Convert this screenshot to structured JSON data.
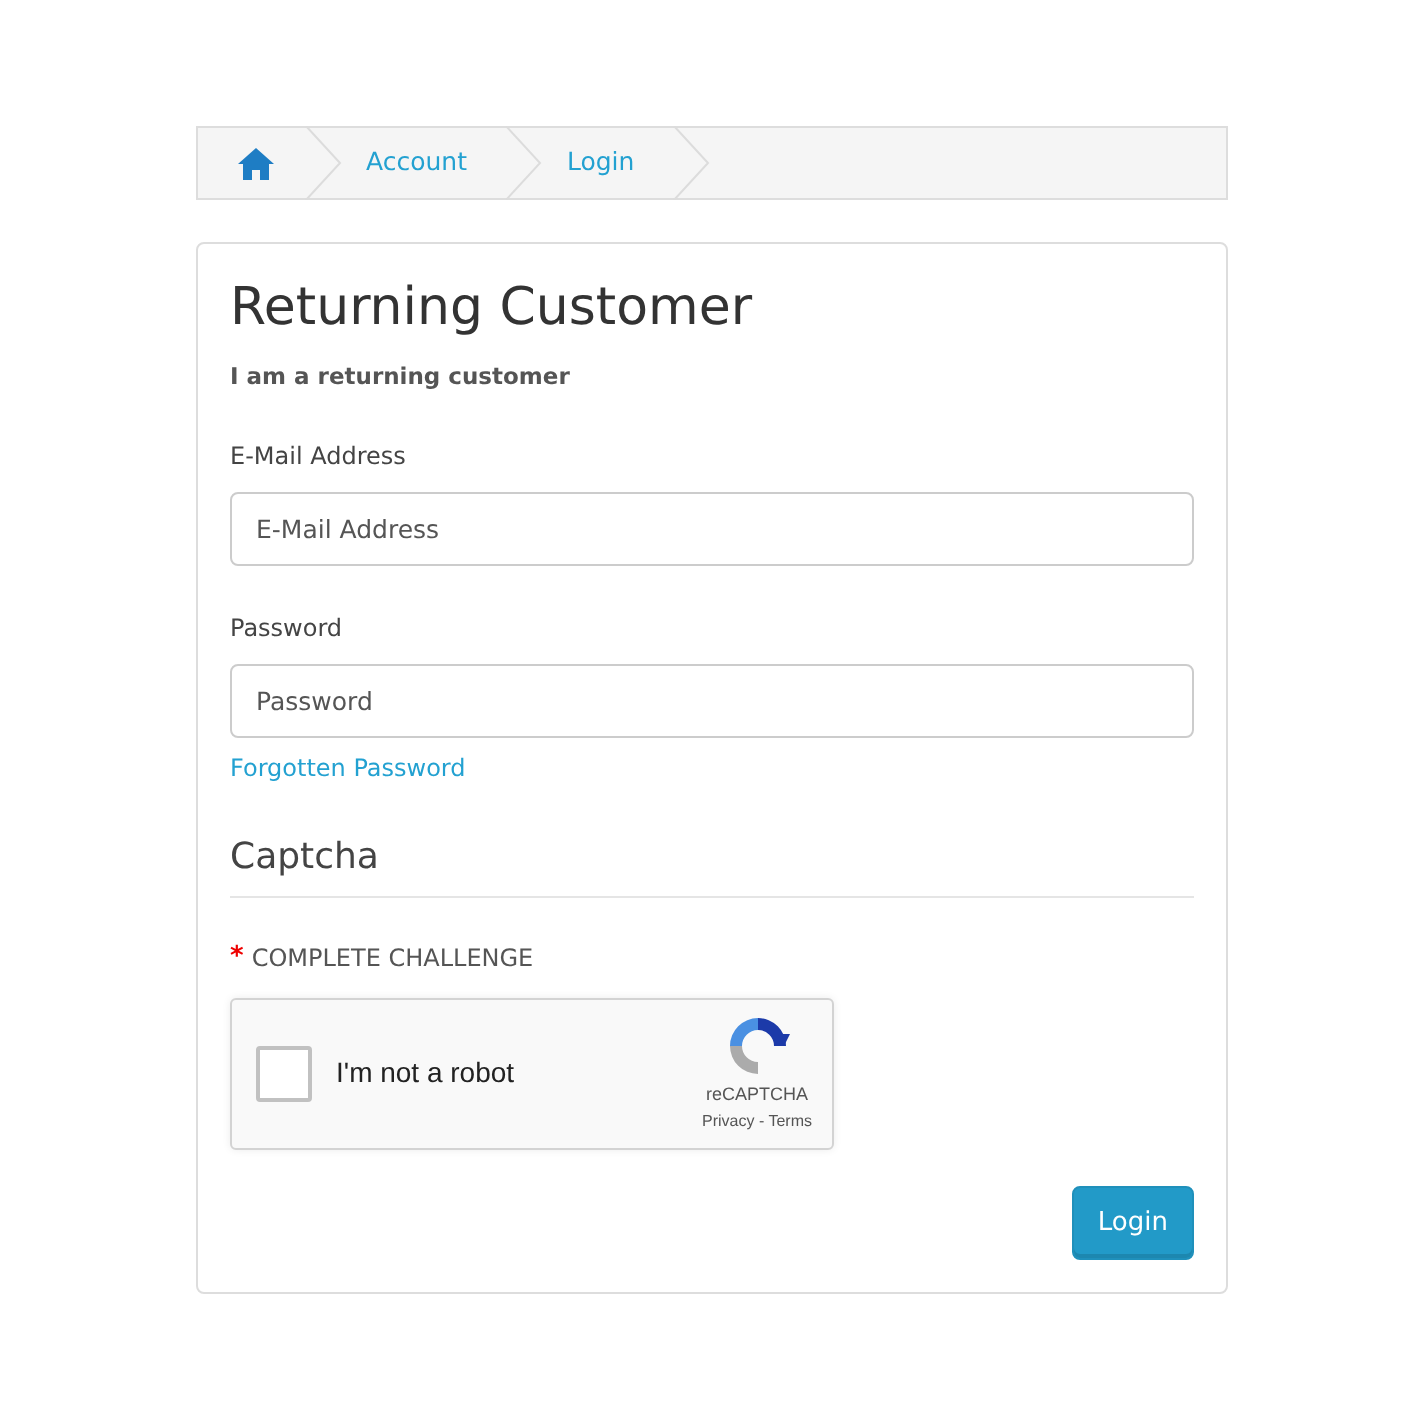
{
  "breadcrumb": [
    {
      "kind": "home"
    },
    {
      "kind": "link",
      "label": "Account"
    },
    {
      "kind": "link",
      "label": "Login"
    }
  ],
  "panel": {
    "title": "Returning Customer",
    "subtitle": "I am a returning customer",
    "fields": [
      {
        "label": "E-Mail Address",
        "placeholder": "E-Mail Address"
      },
      {
        "label": "Password",
        "placeholder": "Password"
      }
    ],
    "forgot_link": "Forgotten Password",
    "captcha": {
      "heading": "Captcha",
      "required_mark": "*",
      "label": "COMPLETE CHALLENGE",
      "checked": false,
      "checkbox_label": "I'm not a robot",
      "brand": "reCAPTCHA",
      "links": "Privacy - Terms"
    },
    "submit": "Login"
  }
}
